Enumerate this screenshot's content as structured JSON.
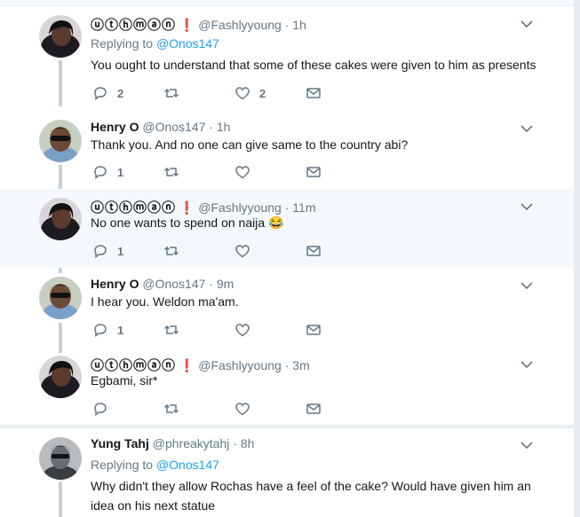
{
  "tweets": [
    {
      "name": "ⓤⓣⓗⓜⓐⓝ",
      "badge": "❗",
      "handle": "@Fashlyyoung",
      "dot": "·",
      "time": "1h",
      "replying_prefix": "Replying to",
      "replying_to": "@Onos147",
      "text": "You ought to understand that some of these cakes were given to him as presents",
      "reply_count": "2",
      "retweet_count": "",
      "like_count": "2"
    },
    {
      "name": "Henry O",
      "handle": "@Onos147",
      "dot": "·",
      "time": "1h",
      "text": "Thank you. And no one can give same to the country abi?",
      "reply_count": "1",
      "retweet_count": "",
      "like_count": ""
    },
    {
      "name": "ⓤⓣⓗⓜⓐⓝ",
      "badge": "❗",
      "handle": "@Fashlyyoung",
      "dot": "·",
      "time": "11m",
      "text": "No one wants to spend on naija 😂",
      "reply_count": "1",
      "retweet_count": "",
      "like_count": ""
    },
    {
      "name": "Henry O",
      "handle": "@Onos147",
      "dot": "·",
      "time": "9m",
      "text": "I hear you. Weldon ma'am.",
      "reply_count": "1",
      "retweet_count": "",
      "like_count": ""
    },
    {
      "name": "ⓤⓣⓗⓜⓐⓝ",
      "badge": "❗",
      "handle": "@Fashlyyoung",
      "dot": "·",
      "time": "3m",
      "text": "Egbami, sir*",
      "reply_count": "",
      "retweet_count": "",
      "like_count": ""
    },
    {
      "name": "Yung Tahj",
      "handle": "@phreakytahj",
      "dot": "·",
      "time": "8h",
      "replying_prefix": "Replying to",
      "replying_to": "@Onos147",
      "text": "Why didn't they allow Rochas have a feel of the cake? Would have given him an idea on his next statue"
    }
  ],
  "colors": {
    "link": "#1da1f2",
    "muted": "#657786",
    "highlight_bg": "#f5f8fa",
    "thread_line": "#c4cfd6"
  }
}
